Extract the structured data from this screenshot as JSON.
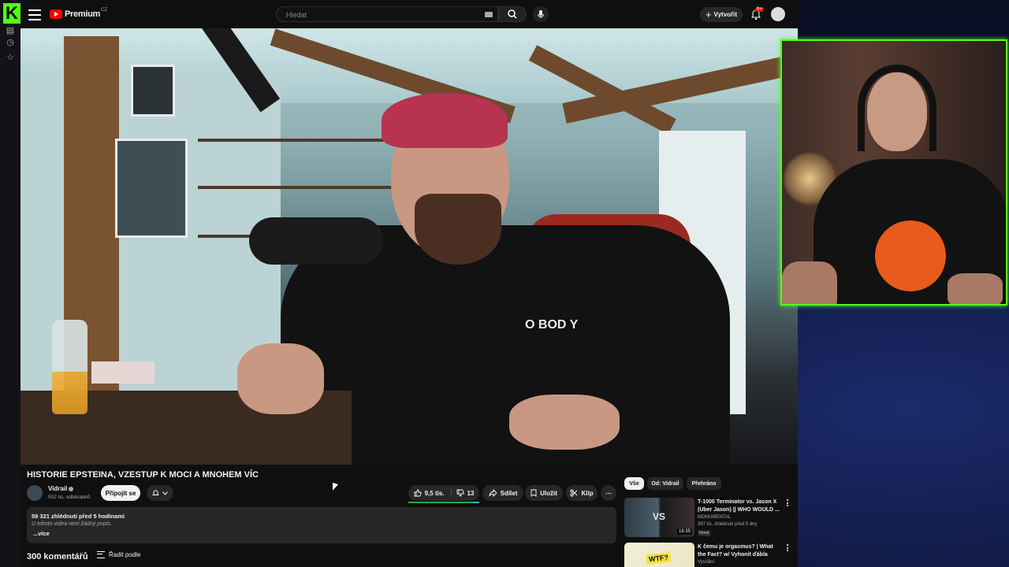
{
  "youtube": {
    "logo_text": "Premium",
    "logo_region": "CZ",
    "search_placeholder": "Hledat",
    "create_label": "Vytvořit",
    "notification_badge": "9+"
  },
  "video": {
    "title": "HISTORIE EPSTEINA, VZESTUP K MOCI A MNOHEM VÍC",
    "channel": "Vidrail",
    "subscribers": "552 tis. odběratelů",
    "join_label": "Připojit se",
    "likes": "9,5 tis.",
    "dislikes": "13",
    "like_ratio": 0.91,
    "share_label": "Sdílet",
    "save_label": "Uložit",
    "clip_label": "Klip",
    "description_stats": "59 321 zhlédnutí  před 5 hodinami",
    "description_text": "U tohoto videa není žádný popis.",
    "more_label": "...více",
    "comments_count": "300 komentářů",
    "sort_label": "Řadit podle",
    "shirt_text": "O BOD Y"
  },
  "filters": [
    "Vše",
    "Od: Vidrail",
    "Přehráno"
  ],
  "recommendations": [
    {
      "title": "T-1000 Terminator vs. Jason X (Uber Jason) || WHO WOULD ...",
      "channel": "MONUMENTAL",
      "meta": "397 tis. zhlédnutí  před 5 dny",
      "badge": "Nový",
      "duration": "16:35",
      "thumb_text": "VS"
    },
    {
      "title": "K čemu je orgasmus? | What the Fact? w/ Vyhonit ďábla",
      "channel": "Vysílání",
      "meta": "",
      "badge": "",
      "duration": "",
      "thumb_text": "WTF?"
    }
  ]
}
